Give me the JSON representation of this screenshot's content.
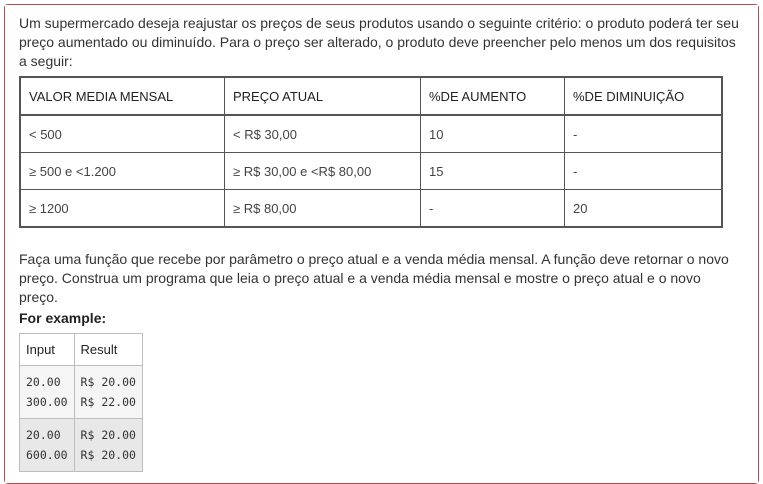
{
  "intro": "Um supermercado deseja reajustar os preços de seus produtos usando o seguinte critério:  o produto poderá ter seu preço aumentado ou diminuído. Para o preço ser alterado, o produto deve preencher pelo menos um dos requisitos a seguir:",
  "criteria_table": {
    "headers": [
      "VALOR MEDIA MENSAL",
      "PREÇO ATUAL",
      "%DE AUMENTO",
      "%DE DIMINUIÇÃO"
    ],
    "rows": [
      [
        "< 500",
        "< R$ 30,00",
        "10",
        "-"
      ],
      [
        "≥ 500 e <1.200",
        "≥ R$ 30,00 e <R$ 80,00",
        "15",
        "-"
      ],
      [
        "≥ 1200",
        "≥ R$ 80,00",
        "-",
        "20"
      ]
    ]
  },
  "task": "Faça uma função que recebe por parâmetro o preço atual e a venda média mensal. A função deve retornar o novo preço. Construa um programa que leia o preço atual e a venda média mensal e mostre o preço atual e o novo preço.",
  "example_heading": "For example:",
  "examples_table": {
    "headers": [
      "Input",
      "Result"
    ],
    "rows": [
      [
        "20.00\n300.00",
        "R$ 20.00\nR$ 22.00"
      ],
      [
        "20.00\n600.00",
        "R$ 20.00\nR$ 20.00"
      ]
    ]
  }
}
